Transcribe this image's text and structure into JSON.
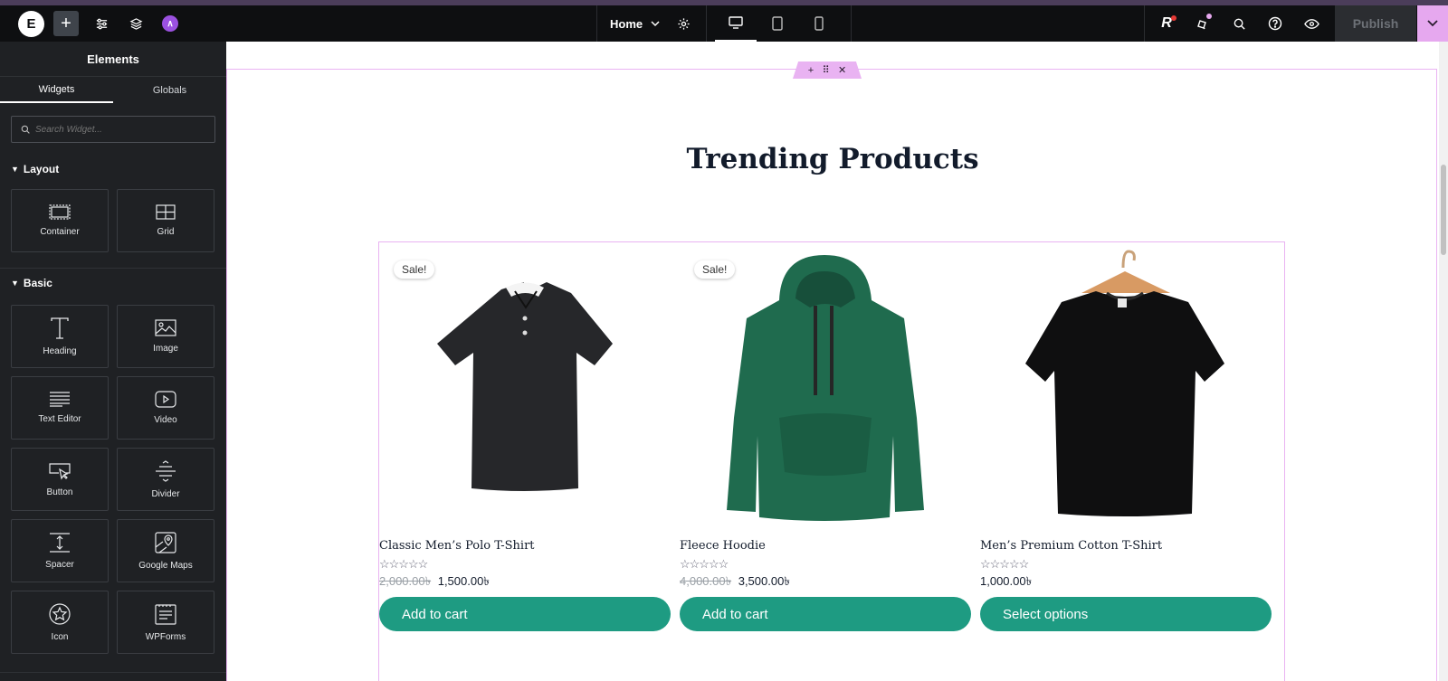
{
  "topbar": {
    "page_name": "Home",
    "publish_label": "Publish"
  },
  "panel": {
    "title": "Elements",
    "tabs": [
      "Widgets",
      "Globals"
    ],
    "search_placeholder": "Search Widget...",
    "sections": [
      {
        "title": "Layout",
        "widgets": [
          "Container",
          "Grid"
        ]
      },
      {
        "title": "Basic",
        "widgets": [
          "Heading",
          "Image",
          "Text Editor",
          "Video",
          "Button",
          "Divider",
          "Spacer",
          "Google Maps",
          "Icon",
          "WPForms"
        ]
      }
    ]
  },
  "canvas": {
    "heading": "Trending Products",
    "products": [
      {
        "badge": "Sale!",
        "name": "Classic Men’s Polo T-Shirt",
        "old_price": "2,000.00৳",
        "price": "1,500.00৳",
        "button": "Add to cart"
      },
      {
        "badge": "Sale!",
        "name": "Fleece Hoodie",
        "old_price": "4,000.00৳",
        "price": "3,500.00৳",
        "button": "Add to cart"
      },
      {
        "badge": "",
        "name": "Men’s Premium Cotton T-Shirt",
        "old_price": "",
        "price": "1,000.00৳",
        "button": "Select options"
      }
    ],
    "rating_stars": "☆☆☆☆☆"
  },
  "colors": {
    "accent": "#1e9b82",
    "selection": "#e9b3f2",
    "panel_bg": "#1f2124",
    "topbar_bg": "#0e0f11"
  }
}
